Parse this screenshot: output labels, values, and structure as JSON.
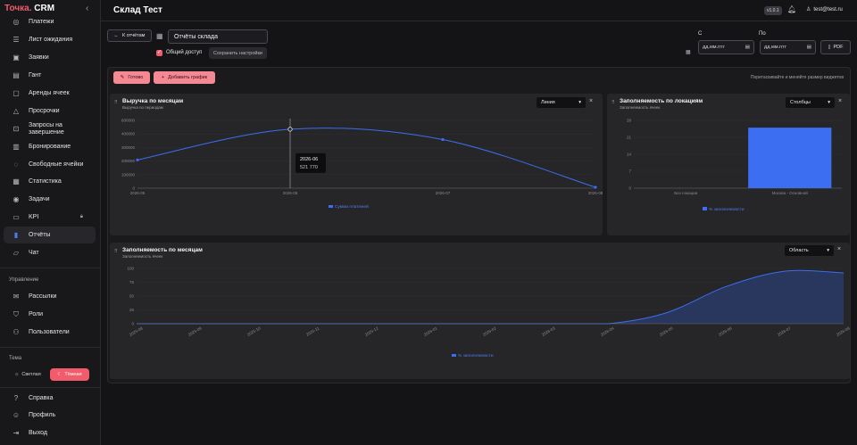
{
  "app": {
    "logo_main": "Точка.",
    "logo_crm": " CRM",
    "collapse_icon": "chevron-left-icon"
  },
  "sidebar": {
    "items": [
      {
        "label": "Платежи",
        "icon": "payments-icon"
      },
      {
        "label": "Лист ожидания",
        "icon": "list-icon"
      },
      {
        "label": "Заявки",
        "icon": "requests-icon"
      },
      {
        "label": "Гант",
        "icon": "gantt-icon"
      },
      {
        "label": "Аренды ячеек",
        "icon": "box-icon"
      },
      {
        "label": "Просрочки",
        "icon": "warning-icon"
      },
      {
        "label": "Запросы на завершение",
        "icon": "request-end-icon"
      },
      {
        "label": "Бронирование",
        "icon": "booking-icon"
      },
      {
        "label": "Свободные ячейки",
        "icon": "cell-icon"
      },
      {
        "label": "Статистика",
        "icon": "stats-icon"
      },
      {
        "label": "Задачи",
        "icon": "tasks-icon"
      },
      {
        "label": "KPI",
        "icon": "kpi-icon"
      },
      {
        "label": "Отчёты",
        "icon": "report-icon"
      },
      {
        "label": "Чат",
        "icon": "chat-icon"
      }
    ],
    "management_title": "Управление",
    "management_items": [
      {
        "label": "Рассылки",
        "icon": "mail-icon"
      },
      {
        "label": "Роли",
        "icon": "shield-icon"
      },
      {
        "label": "Пользователи",
        "icon": "users-icon"
      }
    ],
    "theme_title": "Тема",
    "theme_light": "Светлая",
    "theme_dark": "Тёмная",
    "footer_items": [
      {
        "label": "Справка",
        "icon": "help-icon"
      },
      {
        "label": "Профиль",
        "icon": "profile-icon"
      },
      {
        "label": "Выход",
        "icon": "logout-icon"
      }
    ]
  },
  "header": {
    "title": "Склад Тест",
    "version": "v1.0.1",
    "user": "test@test.ru"
  },
  "toolbar": {
    "back": "К отчётам",
    "report_name": "Отчёты склада",
    "shared": "Общий доступ",
    "save_settings": "Сохранить настройки",
    "from_label": "С",
    "to_label": "По",
    "date_placeholder": "дд.мм.гггг",
    "pdf": "PDF"
  },
  "canvas": {
    "done": "Готово",
    "add_chart": "Добавить график",
    "hint": "Перетаскивайте и меняйте размер виджетов"
  },
  "widgets": [
    {
      "title": "Выручка по месяцам",
      "subtitle": "Выручка по периодам",
      "select": "Линия"
    },
    {
      "title": "Заполняемость по локациям",
      "subtitle": "Заполняемость ячеек",
      "select": "Столбцы"
    },
    {
      "title": "Заполняемость по месяцам",
      "subtitle": "Заполняемость ячеек",
      "select": "Область"
    }
  ],
  "colors": {
    "accent": "#f15b6c",
    "series": "#3b6ef0"
  },
  "chart_data": [
    {
      "type": "line",
      "categories": [
        "2026-05",
        "2026-06",
        "2026-07",
        "2026-08"
      ],
      "series": [
        {
          "name": "Сумма платежей",
          "values": [
            250000,
            521770,
            430000,
            8000
          ]
        }
      ],
      "ylim": [
        0,
        600000
      ],
      "yticks": [
        "0",
        "100000",
        "200000",
        "300000",
        "400000",
        "600000"
      ],
      "tooltip": {
        "label": "2026-06",
        "value": "521 770"
      },
      "legend": "bottom"
    },
    {
      "type": "bar",
      "categories": [
        "Без локации",
        "Москва - Основной"
      ],
      "series": [
        {
          "name": "% заполняемости",
          "values": [
            0,
            25
          ]
        }
      ],
      "ylim": [
        0,
        28
      ],
      "yticks": [
        "0",
        "7",
        "14",
        "21",
        "28"
      ],
      "legend": "bottom"
    },
    {
      "type": "area",
      "categories": [
        "2025-08",
        "2025-09",
        "2025-10",
        "2025-11",
        "2025-12",
        "2026-01",
        "2026-02",
        "2026-03",
        "2026-04",
        "2026-05",
        "2026-06",
        "2026-07",
        "2026-08"
      ],
      "series": [
        {
          "name": "% заполняемости",
          "values": [
            0,
            0,
            0,
            0,
            0,
            0,
            0,
            0,
            0,
            20,
            67,
            95,
            92
          ]
        }
      ],
      "ylim": [
        0,
        100
      ],
      "yticks": [
        "0",
        "25",
        "50",
        "75",
        "100"
      ],
      "legend": "bottom"
    }
  ]
}
